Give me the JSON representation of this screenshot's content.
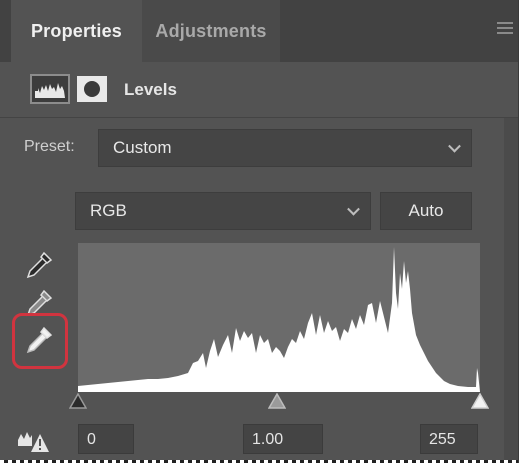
{
  "tabs": [
    {
      "label": "Properties",
      "active": true
    },
    {
      "label": "Adjustments",
      "active": false
    }
  ],
  "header": {
    "title": "Levels",
    "icons": [
      "levels-histogram-icon",
      "layer-mask-icon"
    ]
  },
  "preset": {
    "label": "Preset:",
    "value": "Custom"
  },
  "channel": {
    "value": "RGB",
    "auto_label": "Auto"
  },
  "eyedroppers": [
    "black-point-eyedropper-icon",
    "gray-point-eyedropper-icon",
    "white-point-eyedropper-icon"
  ],
  "highlighted_tool": "white-point-eyedropper",
  "input_levels": {
    "black": "0",
    "gamma": "1.00",
    "white": "255"
  },
  "colors": {
    "panel": "#535353",
    "tabbar": "#424242",
    "histogram_bg": "#6b6b6b",
    "histogram_fill": "#ffffff",
    "highlight": "#d1343f"
  }
}
